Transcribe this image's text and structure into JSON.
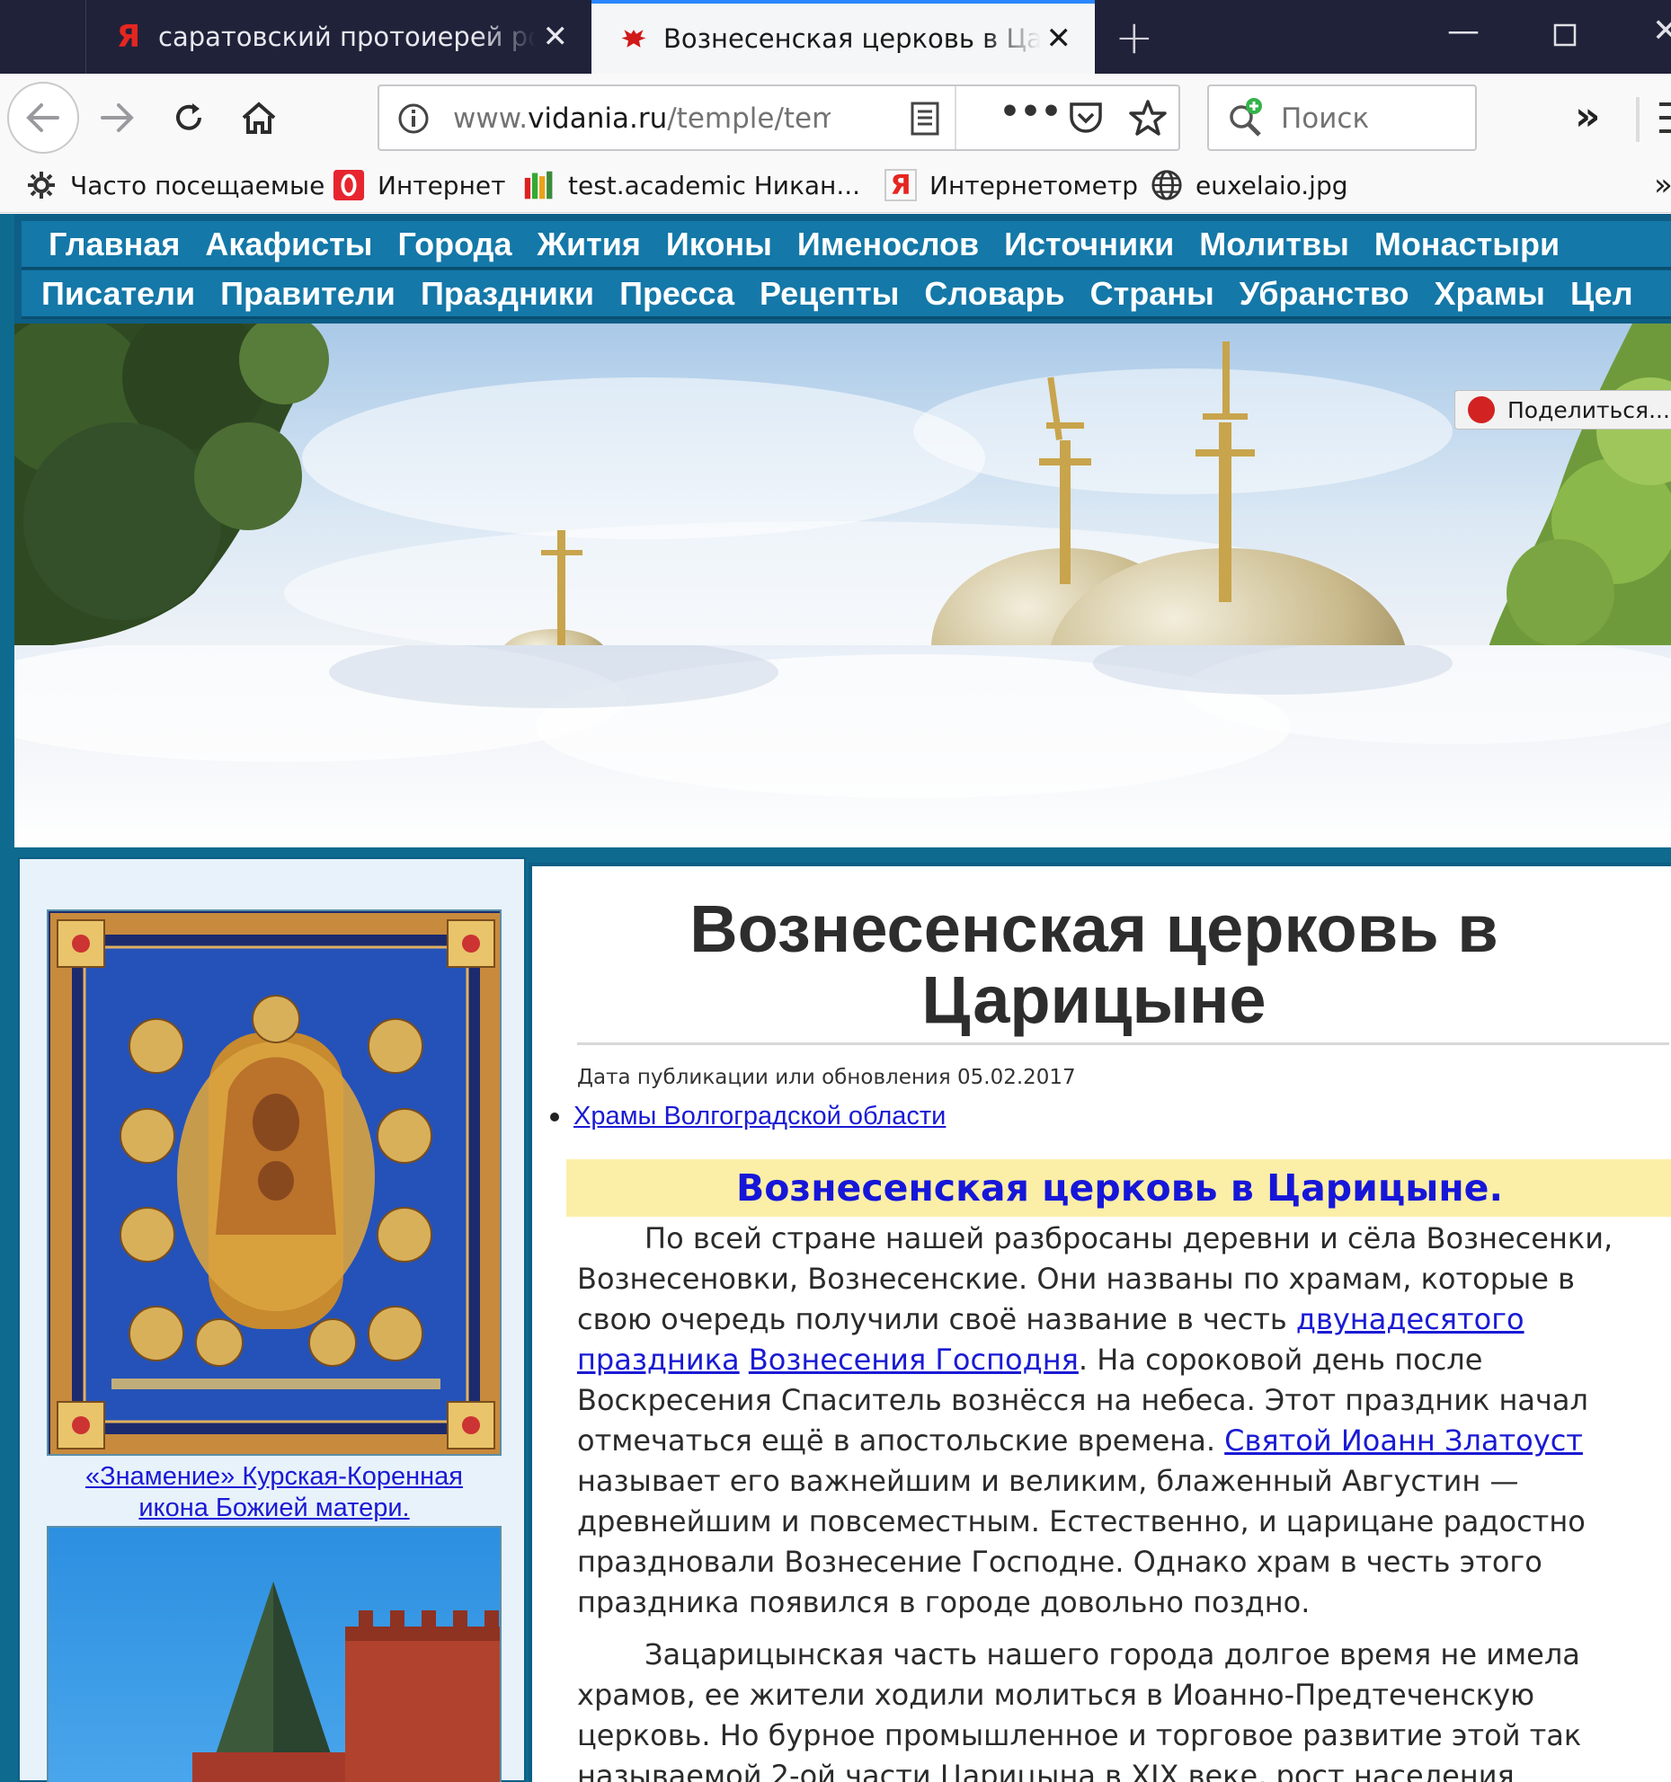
{
  "browser": {
    "tabs": [
      {
        "title": "саратовский протоиерей росс",
        "favicon": "yandex-icon"
      },
      {
        "title": "Вознесенская церковь в Цари",
        "favicon": "eagle-icon",
        "active": true
      }
    ],
    "url_prefix": "www.",
    "url_domain": "vidania.ru",
    "url_path": "/temple/tem",
    "search_placeholder": "Поиск",
    "bookmarks": [
      {
        "label": "Часто посещаемые",
        "icon": "gear-icon"
      },
      {
        "label": "Интернет",
        "icon": "opera-icon"
      },
      {
        "label": "test.academic  Никан...",
        "icon": "books-icon"
      },
      {
        "label": "Интернетометр",
        "icon": "yandex-icon"
      },
      {
        "label": "euxelaio.jpg",
        "icon": "globe-icon"
      }
    ]
  },
  "site": {
    "nav_row1": [
      "Главная",
      "Акафисты",
      "Города",
      "Жития",
      "Иконы",
      "Именослов",
      "Источники",
      "Молитвы",
      "Монастыри"
    ],
    "nav_row2": [
      "Писатели",
      "Правители",
      "Праздники",
      "Пресса",
      "Рецепты",
      "Словарь",
      "Страны",
      "Убранство",
      "Храмы",
      "Цел"
    ],
    "share_label": "Поделиться..."
  },
  "sidebar": {
    "icon_caption_line1": "«Знамение» Курская-Коренная",
    "icon_caption_line2": "икона Божией матери."
  },
  "article": {
    "title": "Вознесенская церковь в Царицыне",
    "pub_date": "Дата публикации или обновления 05.02.2017",
    "category_link": "Храмы Волгоградской области",
    "heading": "Вознесенская церковь в Царицыне.",
    "p1_a": "По всей стране нашей разбросаны деревни и сёла Вознесенки, Вознесеновки, Вознесенские. Они названы по храмам, которые в свою очередь получили своё название в честь ",
    "p1_link1": "двунадесятого праздника",
    "p1_sp": " ",
    "p1_link2": "Вознесения Господня",
    "p1_b": ". На сороковой день после Воскресения Спаситель вознёсся на небеса. Этот праздник начал отмечаться ещё в апостольские времена. ",
    "p1_link3": "Святой Иоанн Златоуст",
    "p1_c": " называет его важнейшим и великим, блаженный Августин — древнейшим и повсеместным. Естественно, и царицане радостно праздновали Вознесение Господне. Однако храм в честь этого праздника появился в городе довольно поздно.",
    "p2": "Зацарицынская часть нашего города долгое время не имела храмов, ее жители ходили молиться в Иоанно-Предтеченскую церковь. Но бурное промышленное и торговое развитие этой так называемой 2-ой части Царицына в XIX веке, рост населения"
  }
}
